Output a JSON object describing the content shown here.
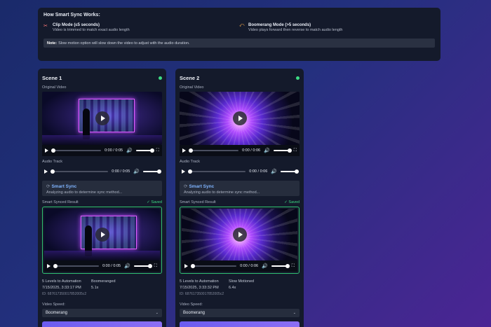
{
  "info": {
    "title": "How Smart Sync Works:",
    "clip": {
      "icon": "scissors-icon",
      "glyph": "✂",
      "name": "Clip Mode (≤5 seconds)",
      "desc": "Video is trimmed to match exact audio length"
    },
    "boomerang": {
      "icon": "boomerang-icon",
      "glyph": "⤺",
      "name": "Boomerang Mode (>5 seconds)",
      "desc": "Video plays forward then reverse to match audio length"
    },
    "note_label": "Note:",
    "note_text": "Slow motion option will slow down the video to adjust with the audio duration."
  },
  "colors": {
    "accent": "#7fb4ff",
    "ok": "#3ddc84",
    "panel": "#141a2b"
  },
  "labels": {
    "original_video": "Original Video",
    "audio_track": "Audio Track",
    "smart_sync": "Smart Sync",
    "sync_prefix": "⟳",
    "smart_result": "Smart Synced Result",
    "saved": "✓ Saved",
    "video_speed": "Video Speed:",
    "play_glyph": "▶",
    "vol_glyph": "🔊",
    "full_glyph": "⛶",
    "chev_glyph": "⌄"
  },
  "scenes": [
    {
      "title": "Scene 1",
      "video_time": "0:00 / 0:05",
      "audio_time": "0:00 / 0:05",
      "sync_desc": "Analyzing audio to determine sync method...",
      "result_time": "0:00 / 0:05",
      "meta": {
        "project": "5 Levels to Automation",
        "mode": "Boomeranged",
        "date": "7/15/2025, 3:33:17 PM",
        "speed": "5.1x",
        "id": "ID: 687617350017852005c2"
      },
      "speed_option": "Boomerang"
    },
    {
      "title": "Scene 2",
      "video_time": "0:00 / 0:06",
      "audio_time": "0:00 / 0:06",
      "sync_desc": "Analyzing audio to determine sync method...",
      "result_time": "0:00 / 0:06",
      "meta": {
        "project": "5 Levels to Automation",
        "mode": "Slow Motioned",
        "date": "7/15/2025, 3:33:32 PM",
        "speed": "6.4x",
        "id": "ID: 687617350017852005c2"
      },
      "speed_option": "Boomerang"
    }
  ]
}
